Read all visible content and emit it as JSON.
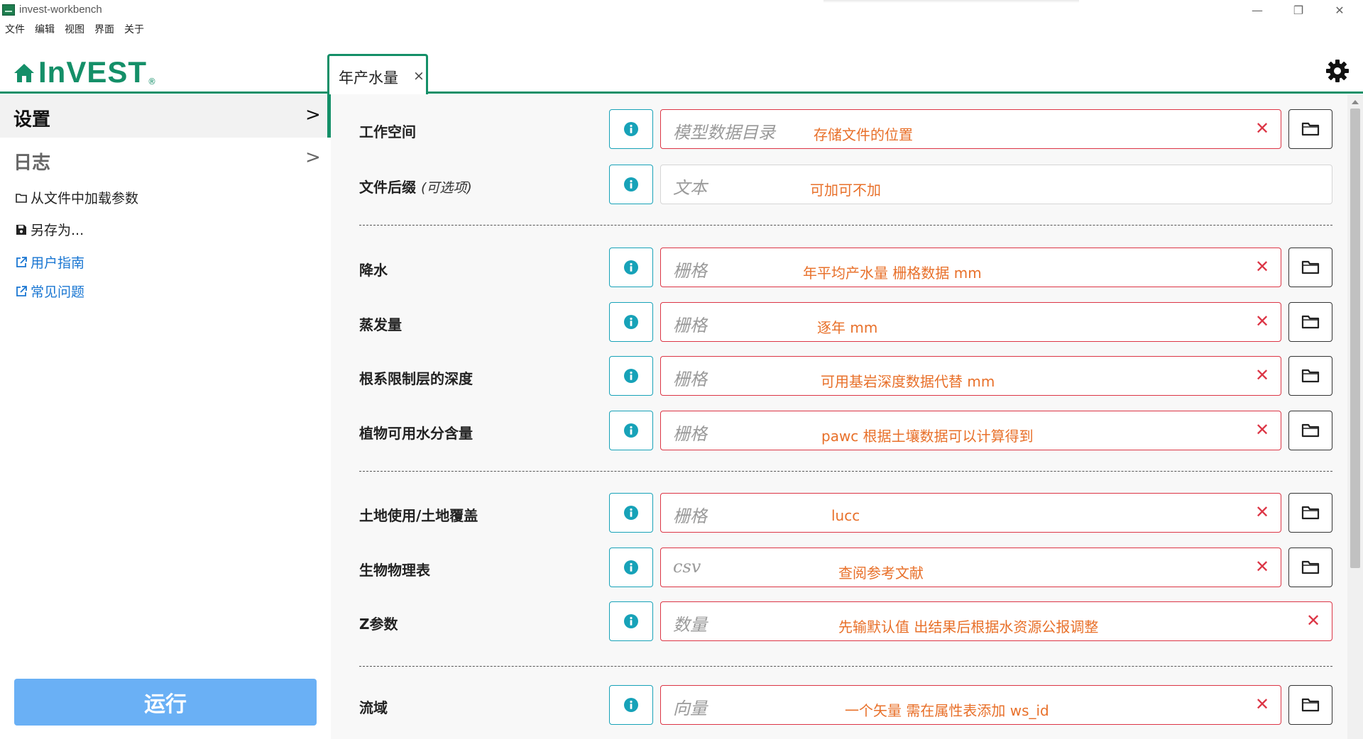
{
  "window": {
    "title": "invest-workbench"
  },
  "menu": [
    "文件",
    "编辑",
    "视图",
    "界面",
    "关于"
  ],
  "brand": {
    "logo_text": "InVEST",
    "registered": "®"
  },
  "tab": {
    "label": "年产水量",
    "close": "×"
  },
  "sidebar": {
    "settings_label": "设置",
    "log_label": "日志",
    "load_params": "从文件中加载参数",
    "save_as": "另存为...",
    "user_guide": "用户指南",
    "faq": "常见问题",
    "run_label": "运行"
  },
  "form": {
    "rows": [
      {
        "label": "工作空间",
        "optional": "",
        "placeholder": "模型数据目录",
        "note": "存储文件的位置",
        "has_clear": true,
        "has_folder": true
      },
      {
        "label": "文件后缀",
        "optional": "(可选项)",
        "placeholder": "文本",
        "note": "可加可不加",
        "has_clear": false,
        "has_folder": false
      },
      {
        "label": "降水",
        "optional": "",
        "placeholder": "栅格",
        "note": "年平均产水量 栅格数据 mm",
        "has_clear": true,
        "has_folder": true
      },
      {
        "label": "蒸发量",
        "optional": "",
        "placeholder": "栅格",
        "note": "逐年 mm",
        "has_clear": true,
        "has_folder": true
      },
      {
        "label": "根系限制层的深度",
        "optional": "",
        "placeholder": "栅格",
        "note": "可用基岩深度数据代替 mm",
        "has_clear": true,
        "has_folder": true
      },
      {
        "label": "植物可用水分含量",
        "optional": "",
        "placeholder": "栅格",
        "note": "pawc 根据土壤数据可以计算得到",
        "has_clear": true,
        "has_folder": true
      },
      {
        "label": "土地使用/土地覆盖",
        "optional": "",
        "placeholder": "栅格",
        "note": "lucc",
        "has_clear": true,
        "has_folder": true
      },
      {
        "label": "生物物理表",
        "optional": "",
        "placeholder": "csv",
        "note": "查阅参考文献",
        "has_clear": true,
        "has_folder": true
      },
      {
        "label": "Z参数",
        "optional": "",
        "placeholder": "数量",
        "note": "先输默认值 出结果后根据水资源公报调整",
        "has_clear": true,
        "has_folder": false
      },
      {
        "label": "流域",
        "optional": "",
        "placeholder": "向量",
        "note": "一个矢量 需在属性表添加 ws_id",
        "has_clear": true,
        "has_folder": true
      }
    ],
    "clear_symbol": "✕"
  },
  "colors": {
    "accent": "#148f68",
    "run": "#6ab0f5",
    "invalid": "#dc3545",
    "info": "#17a2b8",
    "note": "#e8702a",
    "link": "#1976d2"
  },
  "icons": [
    "home-icon",
    "gear-icon",
    "chevron-right-icon",
    "folder-icon",
    "save-icon",
    "external-link-icon",
    "info-icon",
    "clear-icon"
  ]
}
